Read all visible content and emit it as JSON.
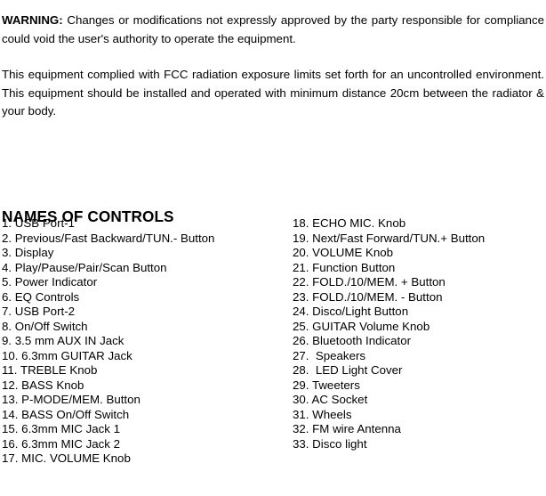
{
  "document": {
    "warning_paragraph": {
      "lead": "WARNING:",
      "body": "  Changes or modifications not expressly approved by the party responsible for compliance could void the user's authority to operate the equipment."
    },
    "fcc_paragraph": {
      "text": "This equipment complied with FCC radiation exposure limits set forth for an uncontrolled environment. This equipment should be installed and operated with minimum distance 20cm between the radiator & your body."
    },
    "section_heading": "NAMES OF CONTROLS",
    "controls": {
      "left_column": [
        "1. USB Port-1",
        "2. Previous/Fast Backward/TUN.- Button",
        "3. Display",
        "4. Play/Pause/Pair/Scan Button",
        "5. Power Indicator",
        "6. EQ Controls",
        "7. USB Port-2",
        "8. On/Off Switch",
        "9. 3.5 mm AUX IN Jack",
        "10. 6.3mm GUITAR Jack",
        "11. TREBLE Knob",
        "12. BASS Knob",
        "13. P-MODE/MEM. Button",
        "14. BASS On/Off Switch",
        "15. 6.3mm MIC Jack 1",
        "16. 6.3mm MIC Jack 2",
        "17. MIC. VOLUME Knob"
      ],
      "right_column": [
        "18. ECHO MIC. Knob",
        "19. Next/Fast Forward/TUN.+ Button",
        "20. VOLUME Knob",
        "21. Function Button",
        "22. FOLD./10/MEM. + Button",
        "23. FOLD./10/MEM. - Button",
        "24. Disco/Light Button",
        "25. GUITAR Volume Knob",
        "26. Bluetooth Indicator",
        "27.  Speakers",
        "28.  LED Light Cover",
        "29. Tweeters",
        "30. AC Socket",
        "31. Wheels",
        "32. FM wire Antenna",
        "33. Disco light"
      ]
    }
  }
}
